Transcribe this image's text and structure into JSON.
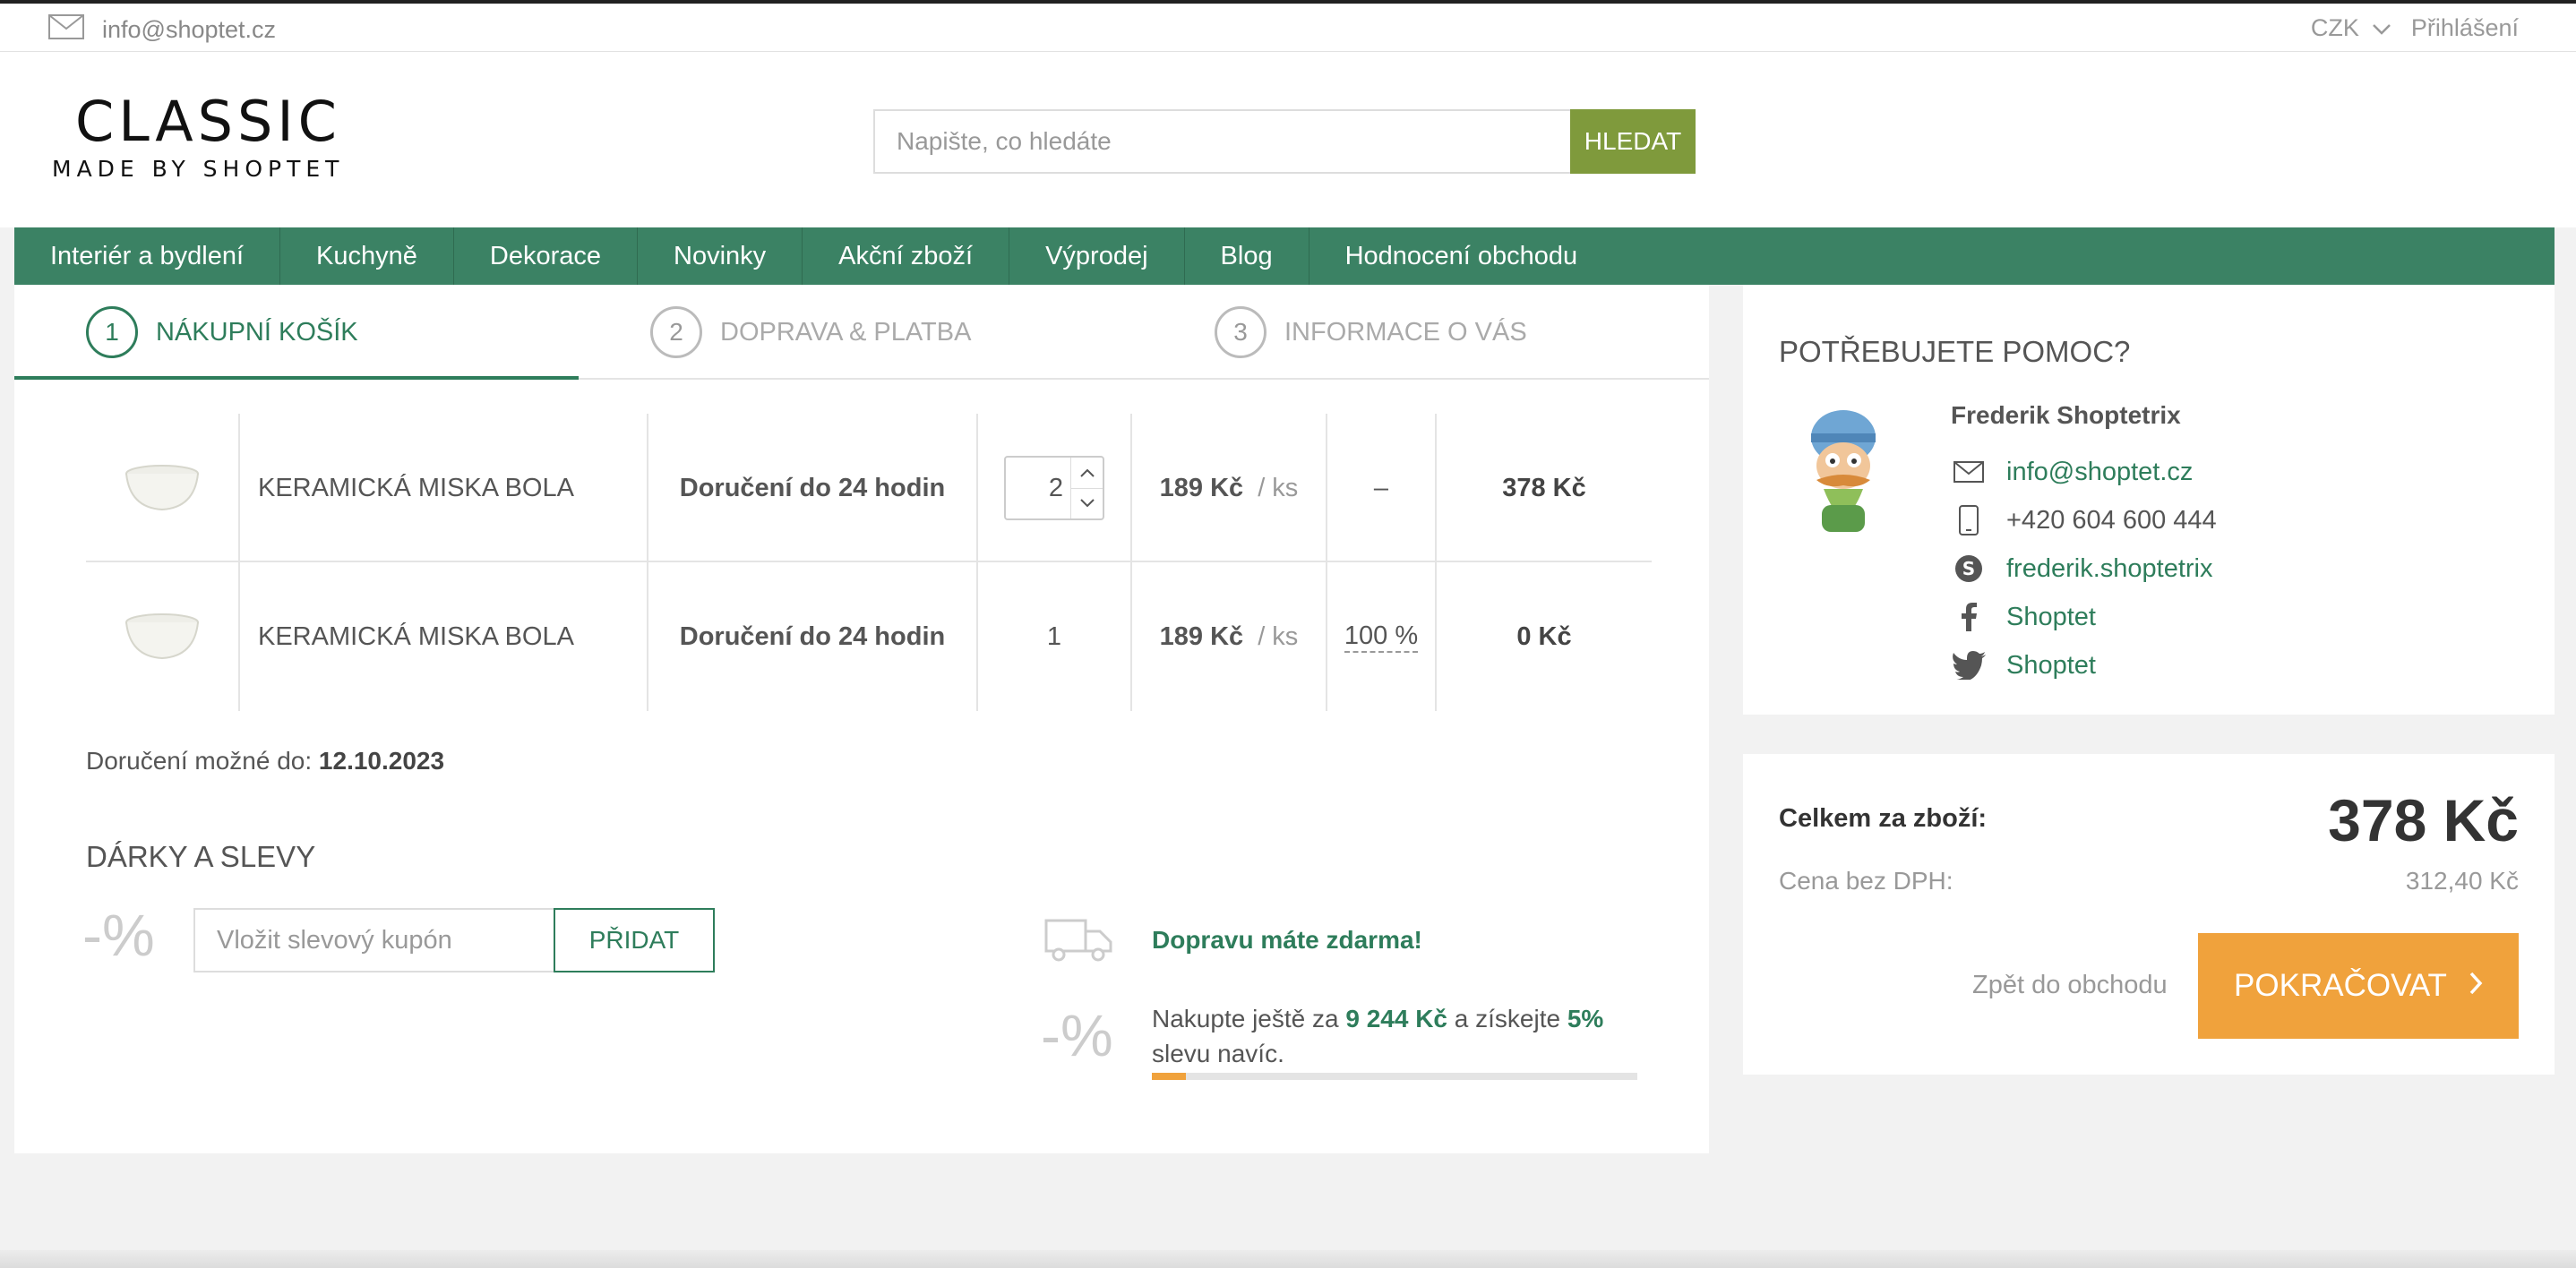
{
  "topbar": {
    "email": "info@shoptet.cz",
    "currency": "CZK",
    "login": "Přihlášení"
  },
  "logo": {
    "line1": "CLASSIC",
    "line2": "MADE BY SHOPTET"
  },
  "search": {
    "placeholder": "Napište, co hledáte",
    "button": "HLEDAT"
  },
  "nav": [
    "Interiér a bydlení",
    "Kuchyně",
    "Dekorace",
    "Novinky",
    "Akční zboží",
    "Výprodej",
    "Blog",
    "Hodnocení obchodu"
  ],
  "steps": [
    {
      "num": "1",
      "label": "NÁKUPNÍ KOŠÍK"
    },
    {
      "num": "2",
      "label": "DOPRAVA & PLATBA"
    },
    {
      "num": "3",
      "label": "INFORMACE O VÁS"
    }
  ],
  "cart": {
    "items": [
      {
        "name": "KERAMICKÁ MISKA BOLA",
        "delivery": "Doručení do 24 hodin",
        "qty": "2",
        "price": "189 Kč",
        "unit": "/ ks",
        "discount": "–",
        "total": "378 Kč"
      },
      {
        "name": "KERAMICKÁ MISKA BOLA",
        "delivery": "Doručení do 24 hodin",
        "qty": "1",
        "price": "189 Kč",
        "unit": "/ ks",
        "discount": "100 %",
        "total": "0 Kč"
      }
    ],
    "delivery_label": "Doručení možné do:",
    "delivery_date": "12.10.2023"
  },
  "gifts": {
    "title": "DÁRKY A SLEVY",
    "pct_symbol": "-%",
    "coupon_placeholder": "Vložit slevový kupón",
    "add_button": "PŘIDAT",
    "free_shipping": "Dopravu máte zdarma!",
    "more_prefix": "Nakupte ještě za",
    "more_amount": "9 244 Kč",
    "more_middle": "a získejte",
    "more_percent": "5%",
    "more_suffix": "slevu navíc.",
    "progress": 0.07
  },
  "help": {
    "title": "POTŘEBUJETE POMOC?",
    "agent_name": "Frederik Shoptetrix",
    "email": "info@shoptet.cz",
    "phone": "+420 604 600 444",
    "skype": "frederik.shoptetrix",
    "facebook": "Shoptet",
    "twitter": "Shoptet"
  },
  "summary": {
    "total_label": "Celkem za zboží:",
    "total_value": "378 Kč",
    "net_label": "Cena bez DPH:",
    "net_value": "312,40 Kč",
    "back": "Zpět do obchodu",
    "continue": "POKRAČOVAT"
  },
  "colors": {
    "brand_green": "#3b8264",
    "accent_orange": "#f0a23c",
    "search_button": "#7f9a3c"
  }
}
